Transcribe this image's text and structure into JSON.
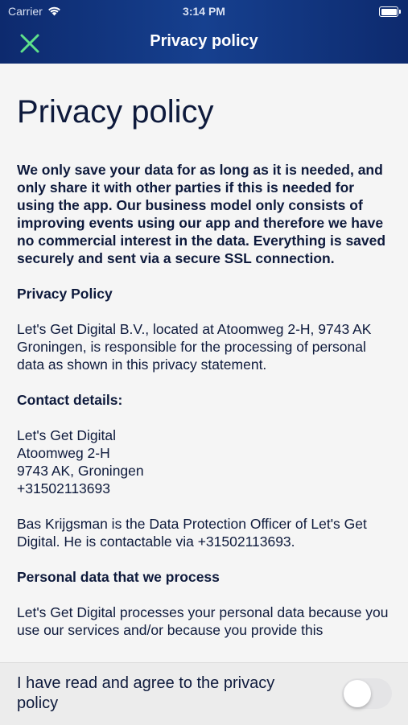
{
  "status_bar": {
    "carrier": "Carrier",
    "time": "3:14 PM"
  },
  "header": {
    "title": "Privacy policy",
    "close_icon": "close-x-icon",
    "accent_color": "#5ee08a"
  },
  "content": {
    "title": "Privacy policy",
    "intro": "We only save your data for as long as it is needed, and only share it with other parties if this is needed for using the app. Our business model only consists of improving events using our app and therefore we have no commercial interest in the data. Everything is saved securely and sent via a secure SSL connection.",
    "privacy_heading": "Privacy Policy",
    "privacy_text": "Let's Get Digital B.V., located at Atoomweg 2-H, 9743 AK Groningen, is responsible for the processing of personal data as shown in this privacy statement.",
    "contact_heading": "Contact details:",
    "contact_lines": [
      "Let's Get Digital",
      "Atoomweg 2-H",
      "9743 AK, Groningen",
      "+31502113693"
    ],
    "officer_text": "Bas Krijgsman is the Data Protection Officer of Let's Get Digital. He is contactable via +31502113693.",
    "personal_heading": "Personal data that we process",
    "personal_text": "Let's Get Digital processes your personal data because you use our services and/or because you provide this"
  },
  "footer": {
    "agree_label": "I have read and agree to the privacy policy",
    "toggle_on": false
  }
}
